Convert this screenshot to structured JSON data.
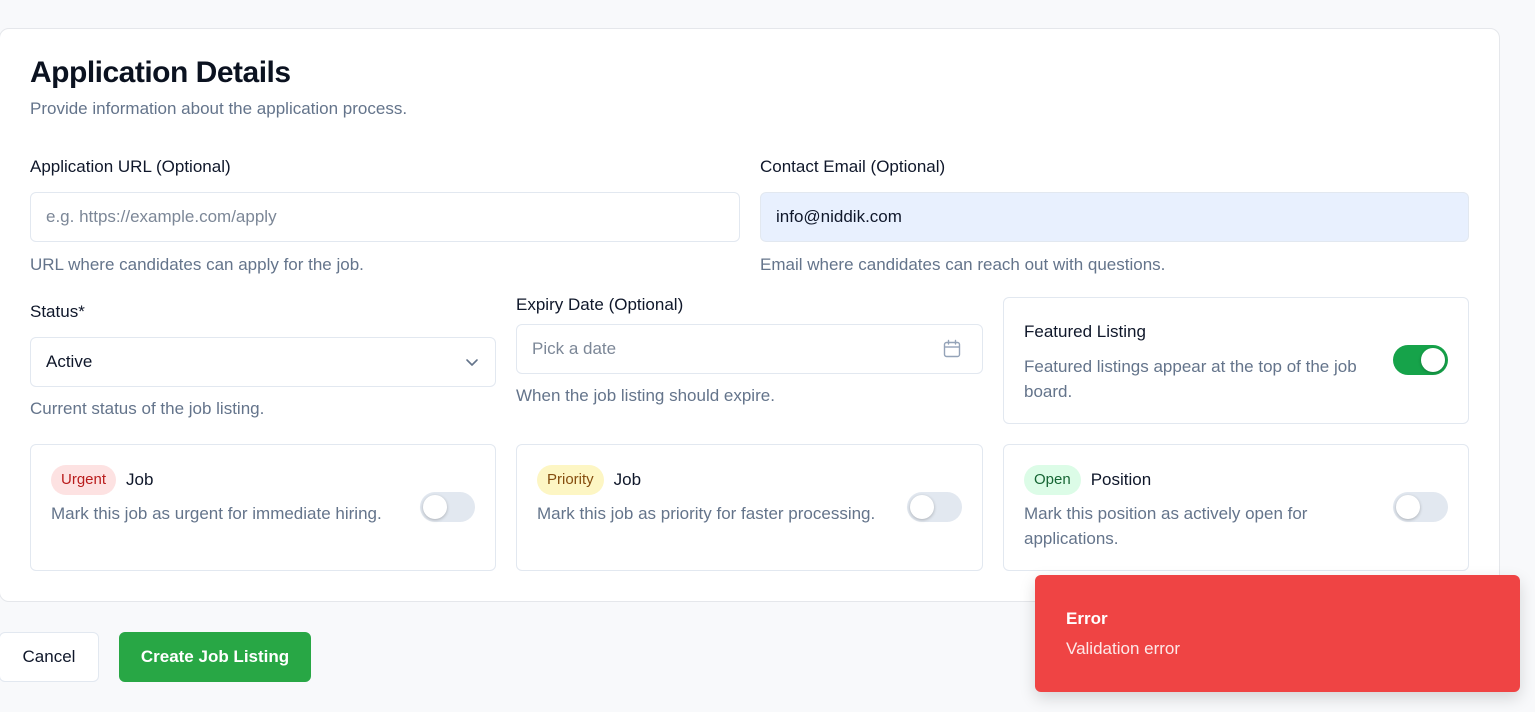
{
  "section": {
    "title": "Application Details",
    "subtitle": "Provide information about the application process."
  },
  "application_url": {
    "label": "Application URL (Optional)",
    "value": "",
    "placeholder": "e.g. https://example.com/apply",
    "help": "URL where candidates can apply for the job."
  },
  "contact_email": {
    "label": "Contact Email (Optional)",
    "value": "info@niddik.com",
    "help": "Email where candidates can reach out with questions."
  },
  "status": {
    "label": "Status*",
    "selected": "Active",
    "help": "Current status of the job listing.",
    "icon": "chevron-down-icon"
  },
  "expiry_date": {
    "label": "Expiry Date (Optional)",
    "placeholder": "Pick a date",
    "help": "When the job listing should expire.",
    "icon": "calendar-icon"
  },
  "featured": {
    "title": "Featured Listing",
    "description": "Featured listings appear at the top of the job board.",
    "enabled": true
  },
  "urgent": {
    "badge": "Urgent",
    "title": "Job",
    "description": "Mark this job as urgent for immediate hiring.",
    "enabled": false
  },
  "priority": {
    "badge": "Priority",
    "title": "Job",
    "description": "Mark this job as priority for faster processing.",
    "enabled": false
  },
  "open_position": {
    "badge": "Open",
    "title": "Position",
    "description": "Mark this position as actively open for applications.",
    "enabled": false
  },
  "actions": {
    "cancel_label": "Cancel",
    "create_label": "Create Job Listing"
  },
  "toast": {
    "title": "Error",
    "message": "Validation error"
  },
  "colors": {
    "accent_green": "#28a745",
    "switch_on": "#16a34a",
    "error": "#ef4444",
    "filled_input": "#e8f0fe"
  }
}
